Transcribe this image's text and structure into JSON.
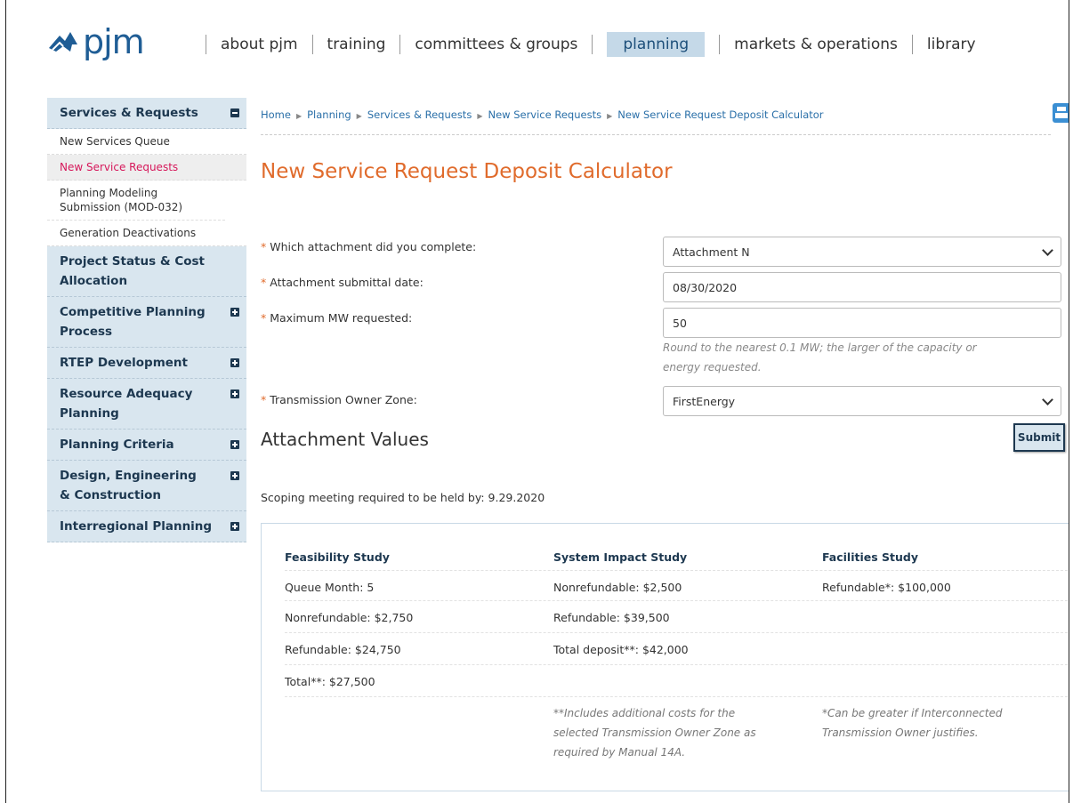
{
  "header": {
    "logo_text": "pjm",
    "nav": [
      {
        "label": "about pjm",
        "active": false
      },
      {
        "label": "training",
        "active": false
      },
      {
        "label": "committees & groups",
        "active": false
      },
      {
        "label": "planning",
        "active": true
      },
      {
        "label": "markets & operations",
        "active": false
      },
      {
        "label": "library",
        "active": false
      }
    ]
  },
  "sidebar": {
    "services_header": "Services & Requests",
    "services_items": [
      {
        "label": "New Services Queue",
        "active": false
      },
      {
        "label": "New Service Requests",
        "active": true
      },
      {
        "label": "Planning Modeling Submission (MOD-032)",
        "active": false
      },
      {
        "label": "Generation Deactivations",
        "active": false
      }
    ],
    "sections": [
      {
        "label": "Project Status & Cost Allocation",
        "icon": "none"
      },
      {
        "label": "Competitive Planning Process",
        "icon": "plus"
      },
      {
        "label": "RTEP Development",
        "icon": "plus"
      },
      {
        "label": "Resource Adequacy Planning",
        "icon": "plus"
      },
      {
        "label": "Planning Criteria",
        "icon": "plus"
      },
      {
        "label": "Design, Engineering & Construction",
        "icon": "plus"
      },
      {
        "label": "Interregional Planning",
        "icon": "plus"
      }
    ]
  },
  "breadcrumb": [
    "Home",
    "Planning",
    "Services & Requests",
    "New Service Requests",
    "New Service Request Deposit Calculator"
  ],
  "page_title": "New Service Request Deposit Calculator",
  "form": {
    "required_mark": "*",
    "attachment_label": "Which attachment did you complete:",
    "attachment_value": "Attachment N",
    "date_label": "Attachment submittal date:",
    "date_value": "08/30/2020",
    "mw_label": "Maximum MW requested:",
    "mw_value": "50",
    "mw_hint_line1": "Round to the nearest 0.1 MW; the larger of the capacity or",
    "mw_hint_line2": "energy requested.",
    "zone_label": "Transmission Owner Zone:",
    "zone_value": "FirstEnergy",
    "submit_label": "Submit"
  },
  "results": {
    "heading": "Attachment Values",
    "scoping": "Scoping meeting required to be held by: 9.29.2020",
    "feasibility": {
      "title": "Feasibility Study",
      "lines": [
        "Queue Month: 5",
        "Nonrefundable: $2,750",
        "Refundable: $24,750",
        "Total**: $27,500"
      ]
    },
    "system_impact": {
      "title": "System Impact Study",
      "lines": [
        "Nonrefundable: $2,500",
        "Refundable: $39,500",
        "Total deposit**: $42,000"
      ],
      "note_lines": [
        "**Includes additional costs for the",
        "selected Transmission Owner Zone as",
        "required by Manual 14A."
      ]
    },
    "facilities": {
      "title": "Facilities Study",
      "lines": [
        "Refundable*: $100,000"
      ],
      "note_lines": [
        "*Can be greater if Interconnected",
        "Transmission Owner justifies."
      ]
    }
  }
}
